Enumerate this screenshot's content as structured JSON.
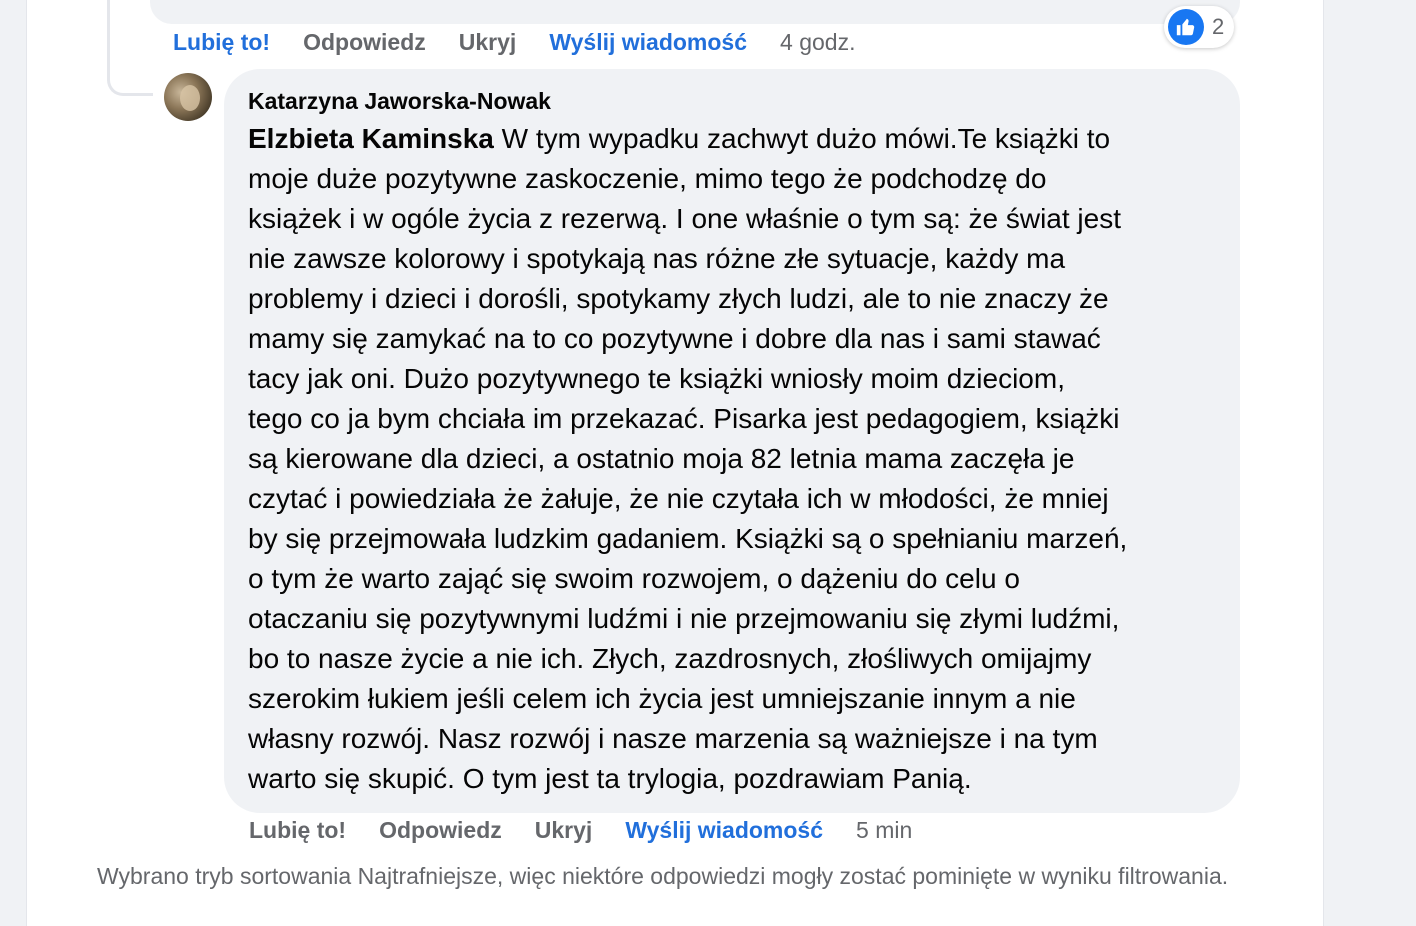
{
  "previous_comment": {
    "actions": {
      "like": "Lubię to!",
      "reply": "Odpowiedz",
      "hide": "Ukryj",
      "message": "Wyślij wiadomość",
      "time": "4 godz."
    },
    "reactions": {
      "icon": "thumbs-up-icon",
      "count": "2",
      "color": "#1877f2"
    }
  },
  "reply": {
    "author": "Katarzyna Jaworska-Nowak",
    "mention": "Elzbieta Kaminska",
    "text": " W tym wypadku zachwyt dużo mówi.Te książki to\nmoje duże pozytywne zaskoczenie, mimo tego że podchodzę do\nksiążek i w ogóle życia z rezerwą. I one właśnie o tym są: że świat jest\nnie zawsze kolorowy i spotykają nas różne złe sytuacje, każdy ma\nproblemy i dzieci i dorośli, spotykamy złych ludzi, ale to nie znaczy że\nmamy się zamykać na to co pozytywne i dobre dla nas i sami stawać\ntacy jak oni. Dużo pozytywnego te książki wniosły moim dzieciom,\ntego co ja bym chciała im przekazać. Pisarka jest pedagogiem, książki\nsą kierowane dla dzieci, a ostatnio moja 82 letnia mama zaczęła je\nczytać i powiedziała że żałuje, że nie czytała ich w młodości, że mniej\nby się przejmowała ludzkim gadaniem. Książki są o spełnianiu marzeń,\no tym że warto zająć się swoim rozwojem, o dążeniu do celu o\notaczaniu się pozytywnymi ludźmi i nie przejmowaniu się złymi ludźmi,\nbo to nasze życie a nie ich. Złych, zazdrosnych, złośliwych omijajmy\nszerokim łukiem jeśli celem ich życia jest umniejszanie innym a nie\nwłasny rozwój. Nasz rozwój i nasze marzenia są ważniejsze i na tym\nwarto się skupić. O tym jest ta trylogia, pozdrawiam Panią.",
    "actions": {
      "like": "Lubię to!",
      "reply": "Odpowiedz",
      "hide": "Ukryj",
      "message": "Wyślij wiadomość",
      "time": "5 min"
    }
  },
  "footnote": "Wybrano tryb sortowania Najtrafniejsze, więc niektóre odpowiedzi mogły zostać pominięte w wyniku filtrowania.",
  "colors": {
    "accent": "#216fdb",
    "muted": "#65676b",
    "bubble": "#f0f2f5"
  }
}
